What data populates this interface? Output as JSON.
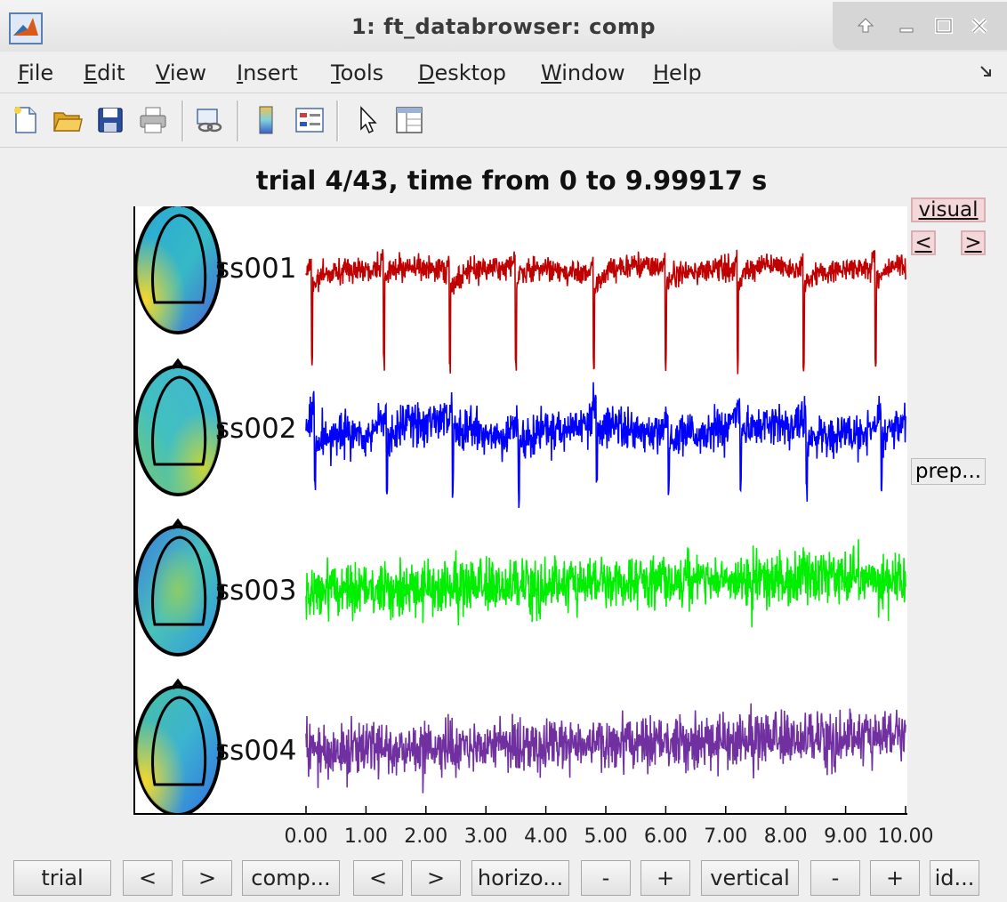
{
  "window": {
    "title": "1: ft_databrowser: comp",
    "controls": [
      "restore-icon",
      "minimize-icon",
      "maximize-icon",
      "close-icon"
    ]
  },
  "menu": {
    "items": [
      "File",
      "Edit",
      "View",
      "Insert",
      "Tools",
      "Desktop",
      "Window",
      "Help"
    ]
  },
  "toolbar": {
    "icons": [
      "new-figure-icon",
      "open-file-icon",
      "save-icon",
      "print-icon",
      "link-icon",
      "colorbar-icon",
      "legend-icon",
      "pointer-icon",
      "property-inspector-icon"
    ]
  },
  "plot": {
    "title": "trial 4/43, time from 0 to 9.99917 s",
    "x_ticks": [
      "0.00",
      "1.00",
      "2.00",
      "3.00",
      "4.00",
      "5.00",
      "6.00",
      "7.00",
      "8.00",
      "9.00",
      "10.00"
    ]
  },
  "chart_data": {
    "type": "line",
    "x_range": [
      0,
      10
    ],
    "series": [
      {
        "name": "ss001",
        "color": "#c00000",
        "style": "spiky",
        "spike_times": [
          0.1,
          1.3,
          2.4,
          3.5,
          4.8,
          6.0,
          7.2,
          8.3,
          9.5
        ]
      },
      {
        "name": "ss002",
        "color": "#0000ff",
        "style": "mixed",
        "spike_times": [
          0.15,
          1.35,
          2.45,
          3.55,
          4.85,
          6.05,
          7.25,
          8.35,
          9.6
        ]
      },
      {
        "name": "ss003",
        "color": "#00ee00",
        "style": "noise"
      },
      {
        "name": "ss004",
        "color": "#7030a0",
        "style": "noise"
      }
    ]
  },
  "side_buttons": {
    "visual": "visual",
    "prev": "<",
    "next": ">",
    "prep": "prep..."
  },
  "bottom_buttons": {
    "trial": "trial",
    "trial_prev": "<",
    "trial_next": ">",
    "comp": "comp...",
    "comp_prev": "<",
    "comp_next": ">",
    "horizontal": "horizo...",
    "h_minus": "-",
    "h_plus": "+",
    "vertical": "vertical",
    "v_minus": "-",
    "v_plus": "+",
    "identify": "id..."
  }
}
